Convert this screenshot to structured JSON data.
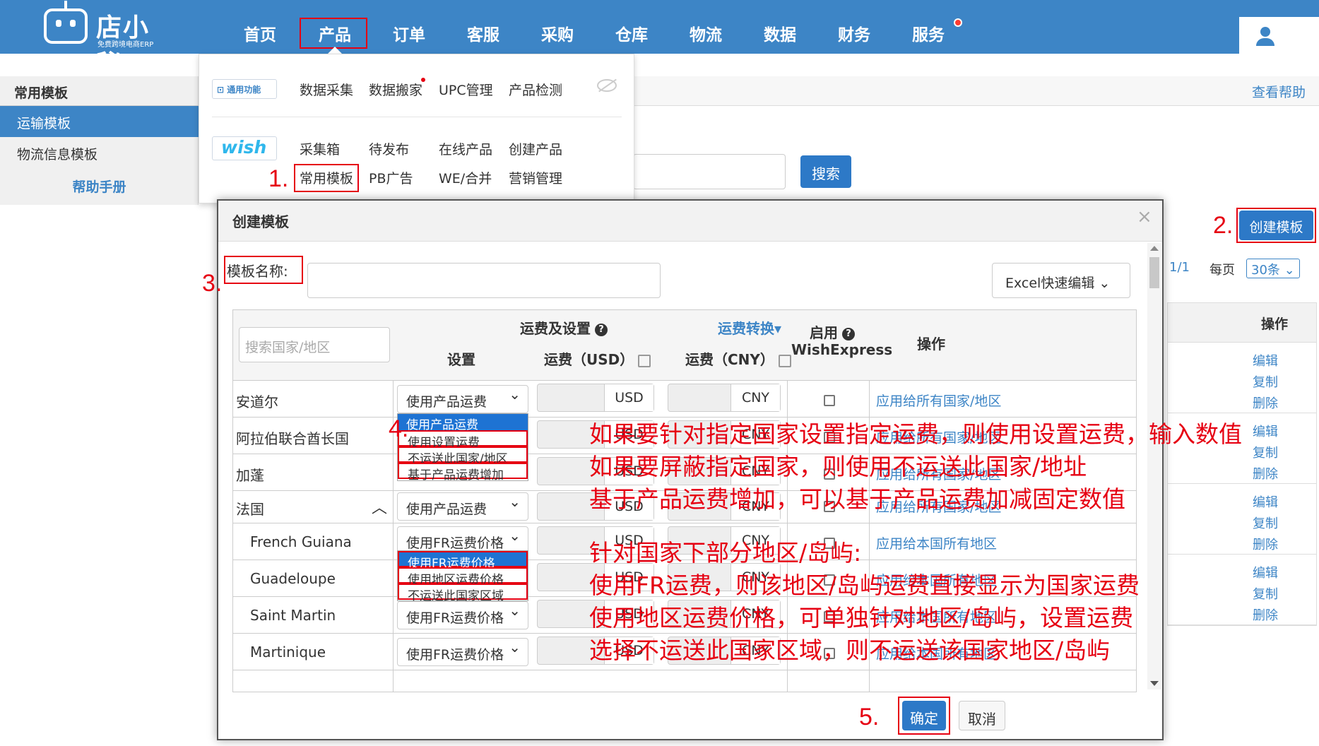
{
  "topbar": {
    "logo_title": "店小秘",
    "logo_sub": "免费跨境电商ERP",
    "nav": [
      "首页",
      "产品",
      "订单",
      "客服",
      "采购",
      "仓库",
      "物流",
      "数据",
      "财务",
      "服务"
    ],
    "active": "产品"
  },
  "sidebar": {
    "header": "常用模板",
    "items": [
      "运输模板",
      "物流信息模板"
    ],
    "help": "帮助手册"
  },
  "main": {
    "help_link": "查看帮助",
    "search_button": "搜索",
    "create_button": "创建模板",
    "pager_pages": "1/1",
    "per_page_label": "每页",
    "per_page_value": "30条",
    "ops_header": "操作",
    "ops": [
      "编辑",
      "复制",
      "删除"
    ]
  },
  "menu": {
    "general_badge": "通用功能",
    "general_items": [
      "数据采集",
      "数据搬家",
      "UPC管理",
      "产品检测"
    ],
    "wish_badge": "wish",
    "wish_row1": [
      "采集箱",
      "待发布",
      "在线产品",
      "创建产品"
    ],
    "wish_row2": [
      "常用模板",
      "PB广告",
      "WE/合并",
      "营销管理"
    ]
  },
  "modal": {
    "title": "创建模板",
    "close": "×",
    "name_label": "模板名称:",
    "excel_button": "Excel快速编辑",
    "country_search_placeholder": "搜索国家/地区",
    "fee_settings": "运费及设置",
    "fee_convert": "运费转换",
    "enable": "启用",
    "wishexpress": "WishExpress",
    "operation": "操作",
    "col_setting": "设置",
    "col_usd": "运费（USD）",
    "col_cny": "运费（CNY）",
    "rows": [
      {
        "name": "安道尔",
        "setting": "使用产品运费",
        "usd": "USD",
        "cny": "CNY",
        "apply": "应用给所有国家/地区"
      },
      {
        "name": "阿拉伯联合酋长国",
        "setting": "",
        "usd": "USD",
        "cny": "CNY",
        "apply": "应用给所有国家/地区"
      },
      {
        "name": "加蓬",
        "setting": "",
        "usd": "USD",
        "cny": "CNY",
        "apply": "应用给所有国家/地区"
      },
      {
        "name": "法国",
        "setting": "使用产品运费",
        "usd": "USD",
        "cny": "CNY",
        "apply": "应用给所有国家/地区"
      },
      {
        "name": "French Guiana",
        "setting": "使用FR运费价格",
        "usd": "USD",
        "cny": "CNY",
        "apply": "应用给本国所有地区"
      },
      {
        "name": "Guadeloupe",
        "setting": "",
        "usd": "USD",
        "cny": "CNY",
        "apply": "应用给本国所有地区"
      },
      {
        "name": "Saint Martin",
        "setting": "使用FR运费价格",
        "usd": "USD",
        "cny": "CNY",
        "apply": "应用给本国所有地区"
      },
      {
        "name": "Martinique",
        "setting": "使用FR运费价格",
        "usd": "USD",
        "cny": "CNY",
        "apply": "应用给本国所有地区"
      }
    ],
    "dropdown1": [
      "使用产品运费",
      "使用设置运费",
      "不运送此国家/地区",
      "基于产品运费增加"
    ],
    "dropdown2": [
      "使用FR运费价格",
      "使用地区运费价格",
      "不运送此国家区域"
    ],
    "ok": "确定",
    "cancel": "取消"
  },
  "annotations": {
    "steps": [
      "1.",
      "2.",
      "3.",
      "4.",
      "5."
    ],
    "lines": [
      "如果要针对指定国家设置指定运费，则使用设置运费，输入数值",
      "如果要屏蔽指定国家，则使用不运送此国家/地址",
      "基于产品运费增加，可以基于产品运费加减固定数值",
      "针对国家下部分地区/岛屿:",
      "使用FR运费，则该地区/岛屿运费直接显示为国家运费",
      "使用地区运费价格，可单独针对地区/岛屿，设置运费",
      "选择不运送此国家区域，则不运送该国家地区/岛屿"
    ]
  },
  "colors": {
    "brand": "#3d85c6",
    "annotation": "#e60012"
  }
}
